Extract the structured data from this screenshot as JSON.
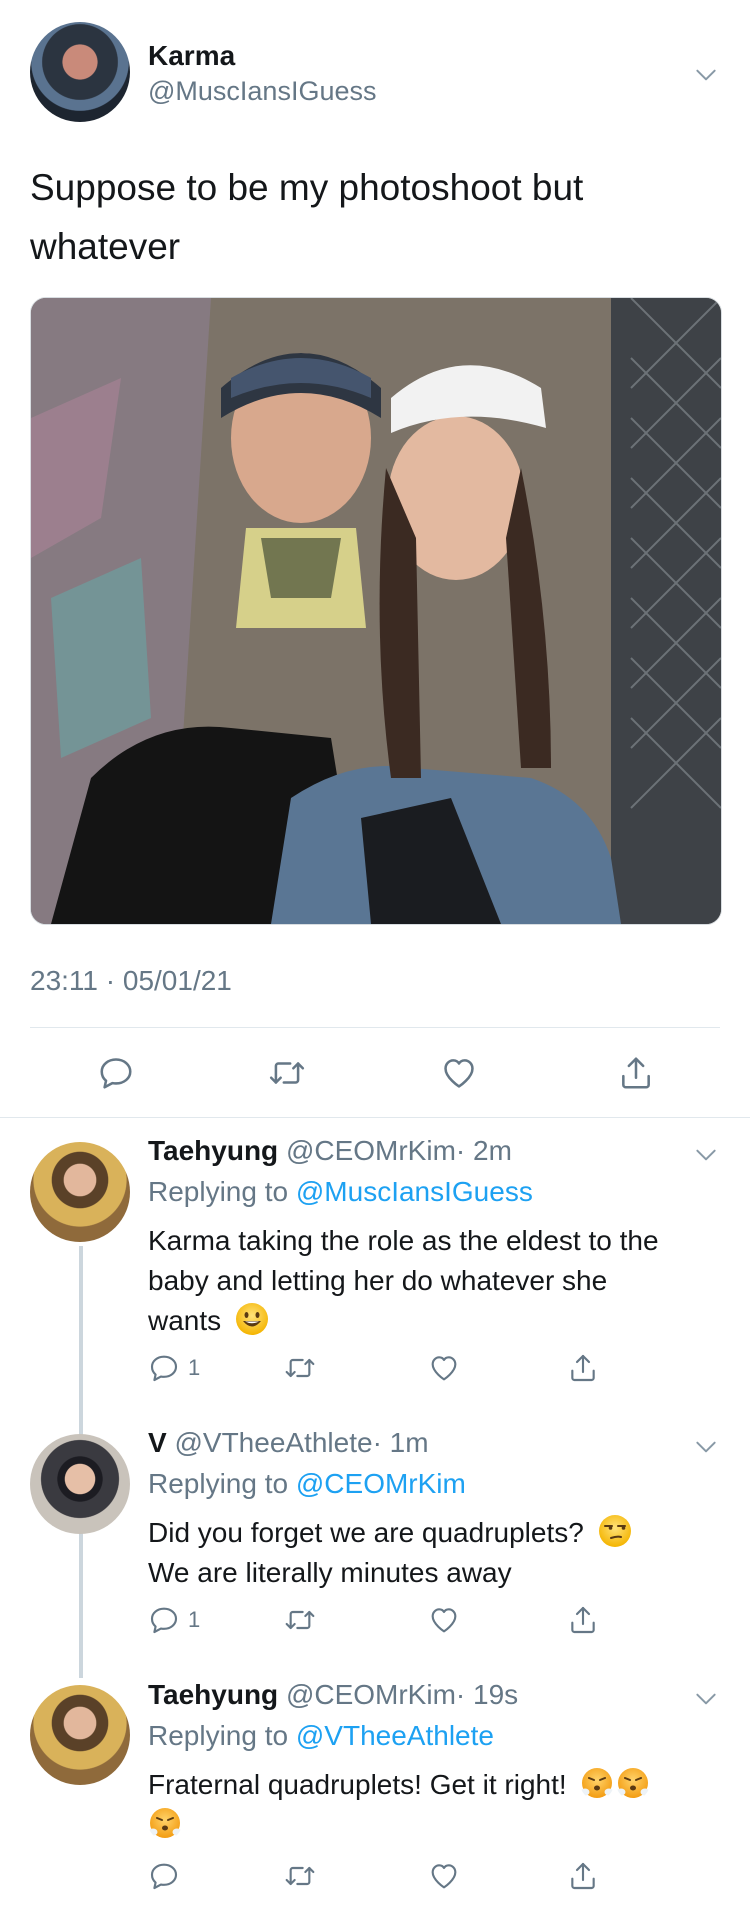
{
  "main_tweet": {
    "name": "Karma",
    "handle": "@MuscIansIGuess",
    "text_line1": "Suppose to be my photoshoot but",
    "text_line2": "whatever",
    "timestamp": "23:11 · 05/01/21"
  },
  "replies": [
    {
      "name": "Taehyung",
      "handle": "@CEOMrKim",
      "time": "· 2m",
      "replying_prefix": "Replying to ",
      "replying_to": "@MuscIansIGuess",
      "lines": [
        "Karma taking the role as the eldest to the",
        "baby and letting her do whatever she",
        "wants"
      ],
      "reply_count": "1"
    },
    {
      "name": "V",
      "handle": "@VTheeAthlete",
      "time": "· 1m",
      "replying_prefix": "Replying to ",
      "replying_to": "@CEOMrKim",
      "lines": [
        "Did you forget we are quadruplets?",
        "We are literally minutes away"
      ],
      "reply_count": "1"
    },
    {
      "name": "Taehyung",
      "handle": "@CEOMrKim",
      "time": "· 19s",
      "replying_prefix": "Replying to ",
      "replying_to": "@VTheeAthlete",
      "lines": [
        "Fraternal quadruplets! Get it right!"
      ],
      "reply_count": ""
    }
  ],
  "colors": {
    "text": "#14171a",
    "gray": "#657786",
    "link": "#1da1f2",
    "divider": "#e1e8ed"
  },
  "icons": [
    "chevron-down-icon",
    "reply-icon",
    "retweet-icon",
    "like-icon",
    "share-icon"
  ]
}
